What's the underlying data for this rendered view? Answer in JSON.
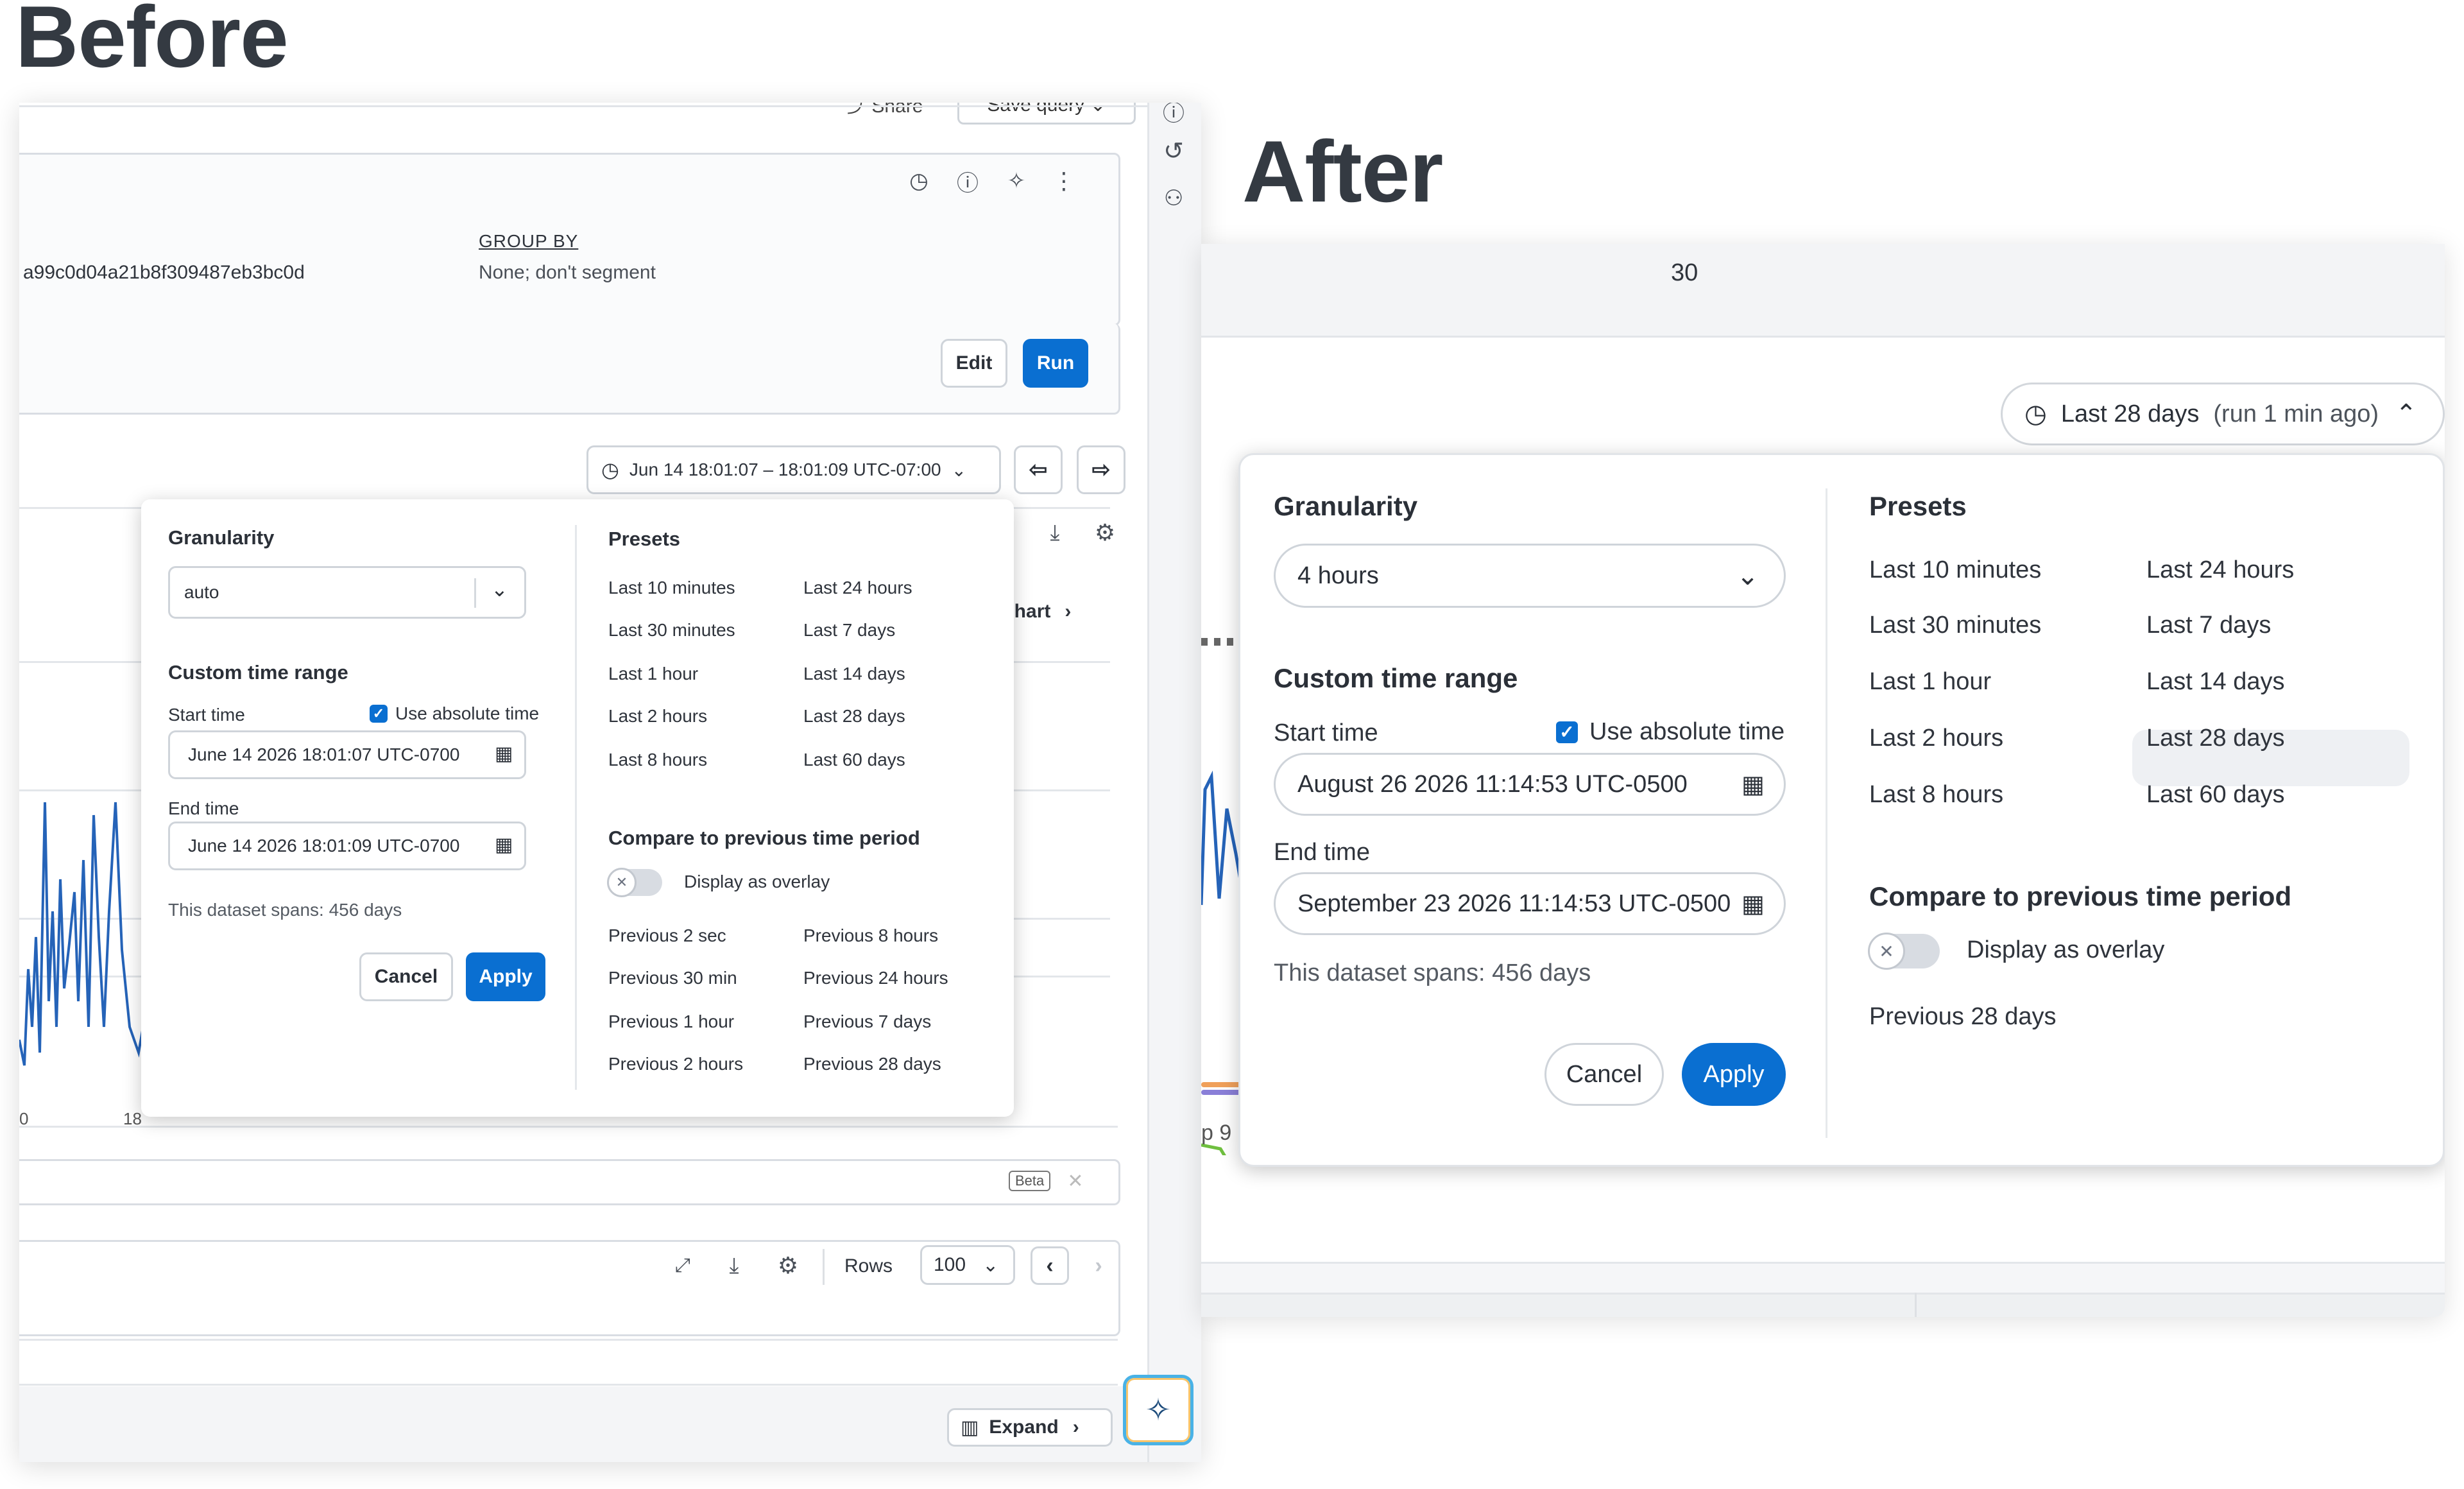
{
  "labels": {
    "before": "Before",
    "after": "After"
  },
  "before": {
    "toolbar": {
      "share": "Share",
      "save_query": "Save query"
    },
    "query": {
      "id_value": "a99c0d04a21b8f309487eb3bc0d",
      "group_by_label": "GROUP BY",
      "group_by_value": "None; don't segment",
      "edit": "Edit",
      "run": "Run"
    },
    "time_range_button": "Jun 14 18:01:07 – 18:01:09 UTC-07:00",
    "chart_link": "chart",
    "chart_axis": {
      "left": "0",
      "right": "18"
    },
    "popover": {
      "granularity_title": "Granularity",
      "granularity_value": "auto",
      "custom_range_title": "Custom time range",
      "start_label": "Start time",
      "use_absolute": "Use absolute time",
      "start_value": "June 14 2026 18:01:07 UTC-0700",
      "end_label": "End time",
      "end_value": "June 14 2026 18:01:09 UTC-0700",
      "dataset_span": "This dataset spans: 456 days",
      "cancel": "Cancel",
      "apply": "Apply",
      "presets_title": "Presets",
      "presets_left": [
        "Last 10 minutes",
        "Last 30 minutes",
        "Last 1 hour",
        "Last 2 hours",
        "Last 8 hours"
      ],
      "presets_right": [
        "Last 24 hours",
        "Last 7 days",
        "Last 14 days",
        "Last 28 days",
        "Last 60 days"
      ],
      "compare_title": "Compare to previous time period",
      "overlay_label": "Display as overlay",
      "previous_left": [
        "Previous 2 sec",
        "Previous 30 min",
        "Previous 1 hour",
        "Previous 2 hours"
      ],
      "previous_right": [
        "Previous 8 hours",
        "Previous 24 hours",
        "Previous 7 days",
        "Previous 28 days"
      ]
    },
    "beta_badge": "Beta",
    "rows_label": "Rows",
    "rows_value": "100",
    "expand": "Expand"
  },
  "after": {
    "header_value": "30",
    "time_range_button": {
      "label": "Last 28 days",
      "suffix": "(run 1 min ago)"
    },
    "chart_peek": "p 9",
    "popover": {
      "granularity_title": "Granularity",
      "granularity_value": "4 hours",
      "custom_range_title": "Custom time range",
      "start_label": "Start time",
      "use_absolute": "Use absolute time",
      "start_value": "August 26 2026 11:14:53 UTC-0500",
      "end_label": "End time",
      "end_value": "September 23 2026 11:14:53 UTC-0500",
      "dataset_span": "This dataset spans: 456 days",
      "cancel": "Cancel",
      "apply": "Apply",
      "presets_title": "Presets",
      "presets_left": [
        "Last 10 minutes",
        "Last 30 minutes",
        "Last 1 hour",
        "Last 2 hours",
        "Last 8 hours"
      ],
      "presets_right": [
        "Last 24 hours",
        "Last 7 days",
        "Last 14 days",
        "Last 28 days",
        "Last 60 days"
      ],
      "selected_preset": "Last 28 days",
      "compare_title": "Compare to previous time period",
      "overlay_label": "Display as overlay",
      "previous_options": [
        "Previous 28 days"
      ]
    }
  },
  "colors": {
    "primary": "#0a6fd1",
    "line": "#2563b8",
    "selected": "#eef0f3"
  }
}
